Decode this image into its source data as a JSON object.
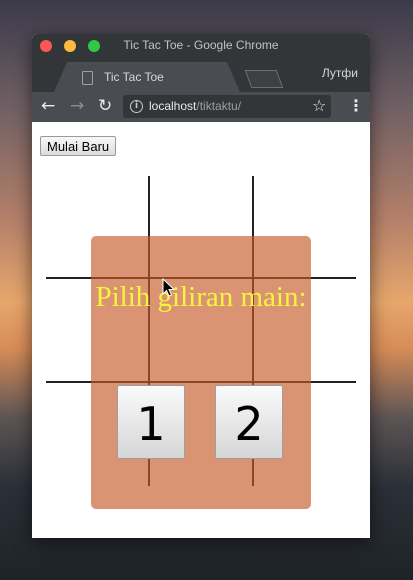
{
  "window": {
    "title": "Tic Tac Toe - Google Chrome",
    "colors": {
      "close": "#fc5753",
      "minimize": "#fdbc40",
      "maximize": "#33c748"
    }
  },
  "tab": {
    "title": "Tic Tac Toe",
    "close_glyph": "×"
  },
  "profile": {
    "name": "Лутфи"
  },
  "toolbar": {
    "back_glyph": "←",
    "forward_glyph": "→",
    "reload_glyph": "↻",
    "url_host": "localhost",
    "url_path": "/tiktaktu/",
    "info_glyph": "i",
    "star_glyph": "☆",
    "menu_glyph": "⋮"
  },
  "page": {
    "restart_label": "Mulai Baru",
    "modal": {
      "prompt": "Pilih giliran main:",
      "choices": [
        "1",
        "2"
      ],
      "background_color": "#c85a28"
    },
    "prompt_color": "#f5f53a"
  }
}
